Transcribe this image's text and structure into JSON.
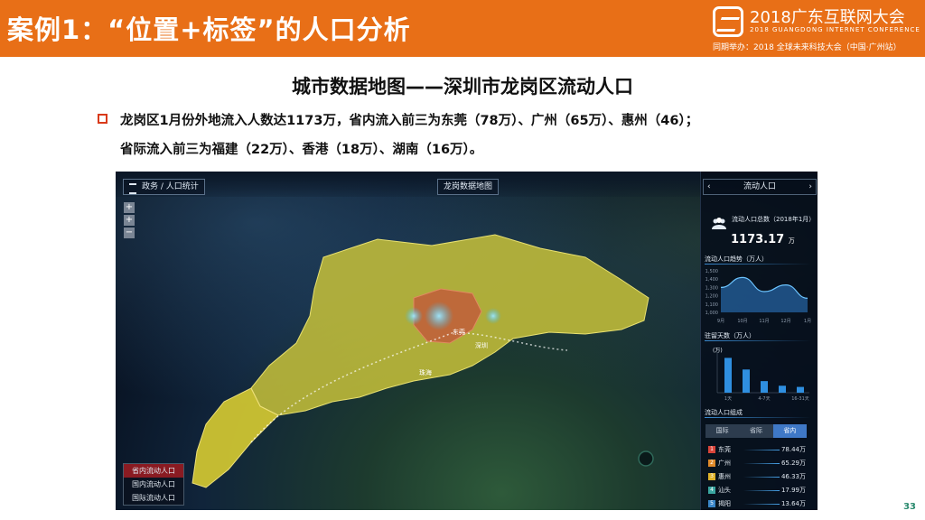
{
  "header": {
    "title": "案例1：“位置+标签”的人口分析",
    "event_title": "2018广东互联网大会",
    "event_en": "2018 GUANGDONG INTERNET CONFERENCE",
    "event_sub": "同期举办：2018 全球未来科技大会（中国·广州站）"
  },
  "main": {
    "title": "城市数据地图——深圳市龙岗区流动人口",
    "desc_line1": "龙岗区1月份外地流入人数达1173万，省内流入前三为东莞（78万）、广州（65万）、惠州（46）；",
    "desc_line2": "省际流入前三为福建（22万）、香港（18万）、湖南（16万）。"
  },
  "dashboard": {
    "breadcrumb": "政务 / 人口统计",
    "map_title": "龙岗数据地图",
    "zoom": [
      "+",
      "+",
      "−"
    ],
    "legend": [
      "省内流动人口",
      "国内流动人口",
      "国际流动人口"
    ],
    "places": [
      "东莞",
      "深圳",
      "珠海"
    ],
    "panel": {
      "title": "流动人口",
      "prev": "‹",
      "next": "›",
      "total_label": "流动人口总数（2018年1月）",
      "total_value": "1173.17",
      "total_unit": "万",
      "trend_title": "流动人口趋势（万人）",
      "stay_title": "驻留天数（万人）",
      "stay_unit": "(万)",
      "composition_title": "流动人口组成",
      "tabs": [
        "国际",
        "省际",
        "省内"
      ],
      "ranking": [
        {
          "rank": "1",
          "city": "东莞",
          "value": "78.44万",
          "color": "#d9443a"
        },
        {
          "rank": "2",
          "city": "广州",
          "value": "65.29万",
          "color": "#e08a2a"
        },
        {
          "rank": "3",
          "city": "惠州",
          "value": "46.33万",
          "color": "#e0b32a"
        },
        {
          "rank": "4",
          "city": "汕头",
          "value": "17.99万",
          "color": "#3aa6a0"
        },
        {
          "rank": "5",
          "city": "揭阳",
          "value": "13.64万",
          "color": "#3a86c8"
        }
      ]
    }
  },
  "chart_data": [
    {
      "type": "area",
      "title": "流动人口趋势（万人）",
      "categories": [
        "9月",
        "10月",
        "11月",
        "12月",
        "1月"
      ],
      "yticks": [
        "1,500",
        "1,400",
        "1,300",
        "1,200",
        "1,100",
        "1,000"
      ],
      "ylim": [
        1000,
        1500
      ],
      "values": [
        1300,
        1420,
        1250,
        1330,
        1170
      ]
    },
    {
      "type": "bar",
      "title": "驻留天数（万人）",
      "categories": [
        "1天",
        "4-7天",
        "16-31天"
      ],
      "bar_count": 5,
      "values": [
        300,
        200,
        100,
        60,
        50
      ],
      "ylim": [
        0,
        350
      ]
    }
  ],
  "page_number": "33",
  "colors": {
    "brand": "#e86f17",
    "bullet": "#d93a1a",
    "page_number": "#2a8a6e"
  }
}
